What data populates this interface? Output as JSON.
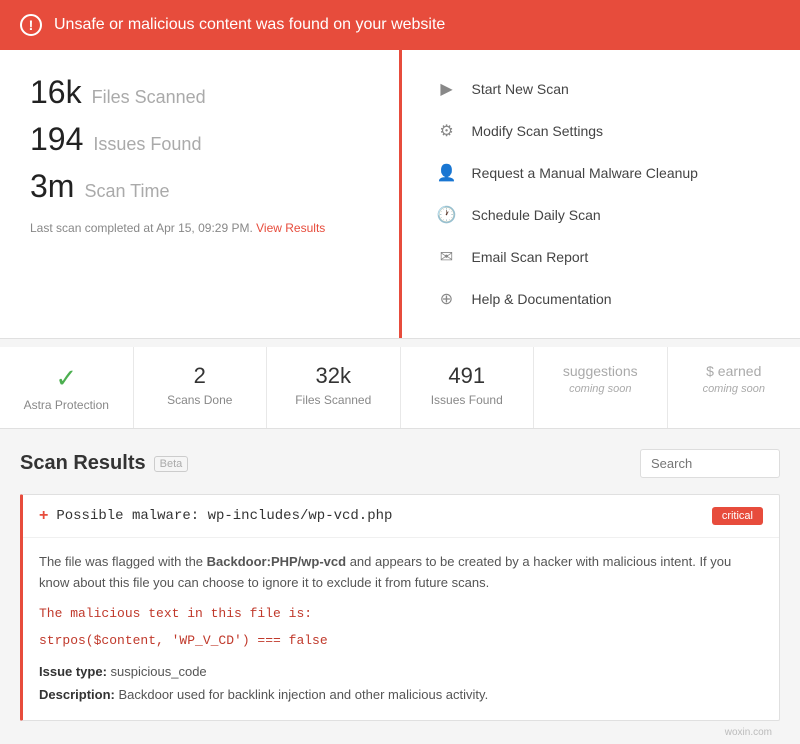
{
  "alert": {
    "icon": "!",
    "message": "Unsafe or malicious content was found on your website"
  },
  "stats": {
    "files_scanned_value": "16k",
    "files_scanned_label": "Files Scanned",
    "issues_found_value": "194",
    "issues_found_label": "Issues Found",
    "scan_time_value": "3m",
    "scan_time_label": "Scan Time",
    "last_scan": "Last scan completed at Apr 15, 09:29 PM.",
    "view_results_link": "View Results"
  },
  "actions": [
    {
      "icon": "▶",
      "label": "Start New Scan"
    },
    {
      "icon": "⚙",
      "label": "Modify Scan Settings"
    },
    {
      "icon": "👤",
      "label": "Request a Manual Malware Cleanup"
    },
    {
      "icon": "🕐",
      "label": "Schedule Daily Scan"
    },
    {
      "icon": "✉",
      "label": "Email Scan Report"
    },
    {
      "icon": "⊕",
      "label": "Help & Documentation"
    }
  ],
  "summary": [
    {
      "value": "✓",
      "label": "Astra Protection",
      "type": "check"
    },
    {
      "value": "2",
      "label": "Scans Done",
      "type": "normal"
    },
    {
      "value": "32k",
      "label": "Files Scanned",
      "type": "normal"
    },
    {
      "value": "491",
      "label": "Issues Found",
      "type": "normal"
    },
    {
      "value": "suggestions",
      "label": "coming soon",
      "type": "soon"
    },
    {
      "value": "$ earned",
      "label": "coming soon",
      "type": "soon"
    }
  ],
  "scan_results": {
    "title": "Scan Results",
    "beta": "Beta",
    "search_placeholder": "Search"
  },
  "issues": [
    {
      "title": "Possible malware: wp-includes/wp-vcd.php",
      "severity": "critical",
      "description": "The file was flagged with the Backdoor:PHP/wp-vcd and appears to be created by a hacker with malicious intent. If you know about this file you can choose to ignore it to exclude it from future scans.",
      "malicious_text_label": "The malicious text in this file is:",
      "malicious_code": "strpos($content, 'WP_V_CD') === false",
      "issue_type_label": "Issue type:",
      "issue_type_value": "suspicious_code",
      "description_label": "Description:",
      "description_value": "Backdoor used for backlink injection and other malicious activity."
    }
  ],
  "watermark": "woxin.com"
}
